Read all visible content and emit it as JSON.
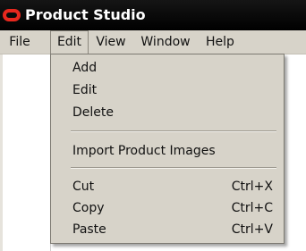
{
  "window": {
    "title": "Product Studio"
  },
  "menubar": {
    "items": [
      {
        "label": "File"
      },
      {
        "label": "Edit"
      },
      {
        "label": "View"
      },
      {
        "label": "Window"
      },
      {
        "label": "Help"
      }
    ],
    "open_menu": "Edit"
  },
  "edit_menu": {
    "items": [
      {
        "label": "Add",
        "shortcut": ""
      },
      {
        "label": "Edit",
        "shortcut": ""
      },
      {
        "label": "Delete",
        "shortcut": ""
      },
      {
        "label": "Import Product Images",
        "shortcut": ""
      },
      {
        "label": "Cut",
        "shortcut": "Ctrl+X"
      },
      {
        "label": "Copy",
        "shortcut": "Ctrl+C"
      },
      {
        "label": "Paste",
        "shortcut": "Ctrl+V"
      }
    ]
  },
  "colors": {
    "titlebar": "#000000",
    "title_text": "#ffffff",
    "logo": "#e8281e",
    "menu_background": "#d7d3c9"
  },
  "icons": {
    "app_logo": "oracle-oval-logo"
  }
}
